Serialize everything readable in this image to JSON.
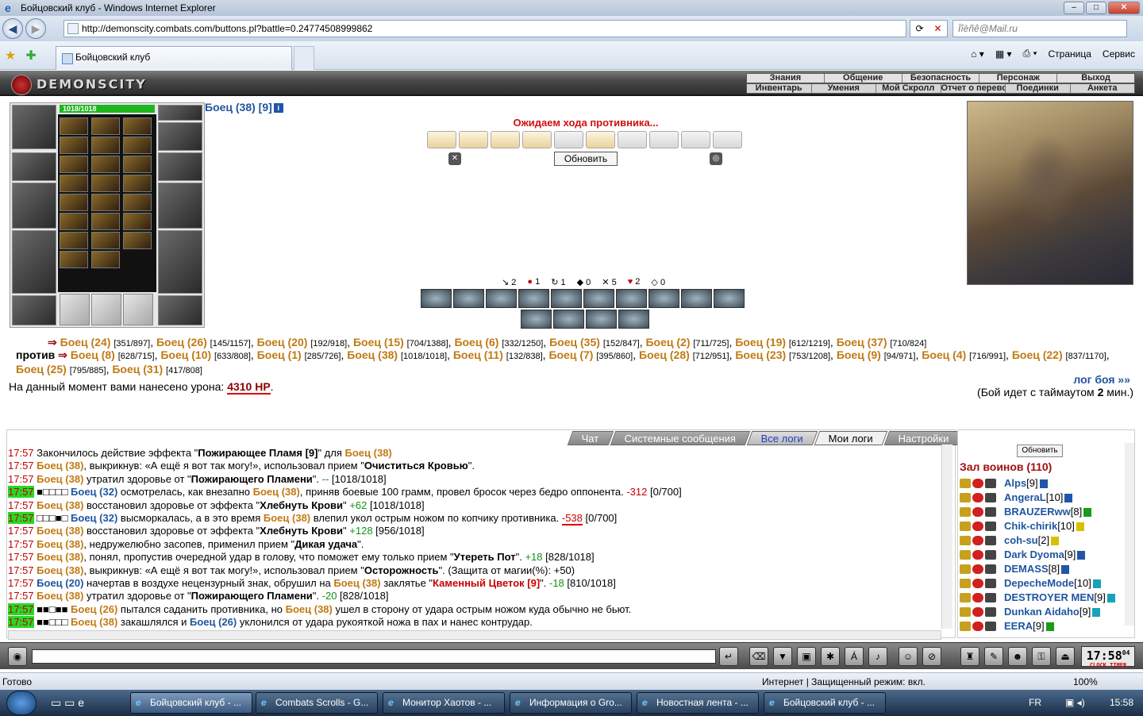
{
  "window": {
    "title": "Бойцовский клуб - Windows Internet Explorer"
  },
  "address": {
    "url": "http://demonscity.combats.com/buttons.pl?battle=0.24774508999862",
    "search_placeholder": "Ïîèñê@Mail.ru"
  },
  "tab": {
    "label": "Бойцовский клуб"
  },
  "toolbar": {
    "page": "Страница",
    "service": "Сервис"
  },
  "game": {
    "logo": "DEMONSCITY",
    "menu_top": [
      "Знания",
      "Общение",
      "Безопасность",
      "Персонаж",
      "Выход"
    ],
    "menu_bottom": [
      "Инвентарь",
      "Умения",
      "Мой Скролл",
      "Отчет о переводах",
      "Поединки",
      "Анкета"
    ],
    "hp": "1018/1018",
    "fighter_name": "Боец (38) [9]",
    "waiting": "Ожидаем хода противника...",
    "refresh_button": "Обновить",
    "stats": [
      "2",
      "1",
      "1",
      "0",
      "5",
      "2",
      "0"
    ],
    "team1": [
      {
        "name": "Боец (24)",
        "hp": "[351/897]"
      },
      {
        "name": "Боец (26)",
        "hp": "[145/1157]"
      },
      {
        "name": "Боец (20)",
        "hp": "[192/918]"
      },
      {
        "name": "Боец (15)",
        "hp": "[704/1388]"
      },
      {
        "name": "Боец (6)",
        "hp": "[332/1250]"
      },
      {
        "name": "Боец (35)",
        "hp": "[152/847]"
      },
      {
        "name": "Боец (2)",
        "hp": "[711/725]"
      },
      {
        "name": "Боец (19)",
        "hp": "[612/1219]"
      },
      {
        "name": "Боец (37)",
        "hp": "[710/824]"
      }
    ],
    "versus": "против",
    "team2": [
      {
        "name": "Боец (8)",
        "hp": "[628/715]"
      },
      {
        "name": "Боец (10)",
        "hp": "[633/808]"
      },
      {
        "name": "Боец (1)",
        "hp": "[285/726]"
      },
      {
        "name": "Боец (38)",
        "hp": "[1018/1018]"
      },
      {
        "name": "Боец (11)",
        "hp": "[132/838]"
      },
      {
        "name": "Боец (7)",
        "hp": "[395/860]"
      },
      {
        "name": "Боец (28)",
        "hp": "[712/951]"
      },
      {
        "name": "Боец (23)",
        "hp": "[753/1208]"
      },
      {
        "name": "Боец (9)",
        "hp": "[94/971]"
      },
      {
        "name": "Боец (4)",
        "hp": "[716/991]"
      },
      {
        "name": "Боец (22)",
        "hp": "[837/1170]"
      },
      {
        "name": "Боец (25)",
        "hp": "[795/885]"
      },
      {
        "name": "Боец (31)",
        "hp": "[417/808]"
      }
    ],
    "damage_text": "На данный момент вами нанесено урона:",
    "damage_value": "4310 HP",
    "log_link": "лог боя »»",
    "timeout_text": "(Бой идет с таймаутом",
    "timeout_value": "2",
    "timeout_suffix": "мин.)"
  },
  "log_tabs": [
    "Чат",
    "Системные сообщения",
    "Все логи",
    "Мои логи",
    "Настройки"
  ],
  "log_lines": [
    {
      "time": "17:57",
      "hl": false,
      "parts": [
        [
          "t",
          "Закончилось действие эффекта \""
        ],
        [
          "b",
          "Пожирающее Пламя [9]"
        ],
        [
          "t",
          "\" для "
        ],
        [
          "bc",
          "Боец (38)"
        ]
      ]
    },
    {
      "time": "17:57",
      "hl": false,
      "parts": [
        [
          "bc",
          "Боец (38)"
        ],
        [
          "t",
          ", выкрикнув: «А ещё я вот так могу!», использовал прием \""
        ],
        [
          "b",
          "Очиститься Кровью"
        ],
        [
          "t",
          "\"."
        ]
      ]
    },
    {
      "time": "17:57",
      "hl": false,
      "parts": [
        [
          "bc",
          "Боец (38)"
        ],
        [
          "t",
          " утратил здоровье от \""
        ],
        [
          "b",
          "Пожирающего Пламени"
        ],
        [
          "t",
          "\". "
        ],
        [
          "gr",
          "--"
        ],
        [
          "t",
          " [1018/1018]"
        ]
      ]
    },
    {
      "time": "17:57",
      "hl": true,
      "parts": [
        [
          "t",
          "■□□□□ "
        ],
        [
          "bl",
          "Боец (32)"
        ],
        [
          "t",
          " осмотрелась, как внезапно "
        ],
        [
          "bc",
          "Боец (38)"
        ],
        [
          "t",
          ", приняв боевые 100 грамм, провел бросок через бедро оппонента. "
        ],
        [
          "rd",
          "-312"
        ],
        [
          "t",
          " [0/700]"
        ]
      ]
    },
    {
      "time": "17:57",
      "hl": false,
      "parts": [
        [
          "bc",
          "Боец (38)"
        ],
        [
          "t",
          " восстановил здоровье от эффекта \""
        ],
        [
          "b",
          "Хлебнуть Крови"
        ],
        [
          "t",
          "\" "
        ],
        [
          "gr",
          "+62"
        ],
        [
          "t",
          " [1018/1018]"
        ]
      ]
    },
    {
      "time": "17:57",
      "hl": true,
      "parts": [
        [
          "t",
          "□□□■□ "
        ],
        [
          "bl",
          "Боец (32)"
        ],
        [
          "t",
          " высморкалась, а в это время "
        ],
        [
          "bc",
          "Боец (38)"
        ],
        [
          "t",
          " влепил укол острым ножом по копчику противника. "
        ],
        [
          "rdu",
          "-538"
        ],
        [
          "t",
          " [0/700]"
        ]
      ]
    },
    {
      "time": "17:57",
      "hl": false,
      "parts": [
        [
          "bc",
          "Боец (38)"
        ],
        [
          "t",
          " восстановил здоровье от эффекта \""
        ],
        [
          "b",
          "Хлебнуть Крови"
        ],
        [
          "t",
          "\" "
        ],
        [
          "gr",
          "+128"
        ],
        [
          "t",
          " [956/1018]"
        ]
      ]
    },
    {
      "time": "17:57",
      "hl": false,
      "parts": [
        [
          "bc",
          "Боец (38)"
        ],
        [
          "t",
          ", недружелюбно засопев, применил прием \""
        ],
        [
          "b",
          "Дикая удача"
        ],
        [
          "t",
          "\"."
        ]
      ]
    },
    {
      "time": "17:57",
      "hl": false,
      "parts": [
        [
          "bc",
          "Боец (38)"
        ],
        [
          "t",
          ", понял, пропустив очередной удар в голову, что поможет ему только прием \""
        ],
        [
          "b",
          "Утереть Пот"
        ],
        [
          "t",
          "\". "
        ],
        [
          "gr",
          "+18"
        ],
        [
          "t",
          " [828/1018]"
        ]
      ]
    },
    {
      "time": "17:57",
      "hl": false,
      "parts": [
        [
          "bc",
          "Боец (38)"
        ],
        [
          "t",
          ", выкрикнув: «А ещё я вот так могу!», использовал прием \""
        ],
        [
          "b",
          "Осторожность"
        ],
        [
          "t",
          "\". (Защита от магии(%): +50)"
        ]
      ]
    },
    {
      "time": "17:57",
      "hl": false,
      "parts": [
        [
          "bl",
          "Боец (20)"
        ],
        [
          "t",
          " начертав в воздухе нецензурный знак, обрушил на "
        ],
        [
          "bc",
          "Боец (38)"
        ],
        [
          "t",
          " заклятье \""
        ],
        [
          "rb",
          "Каменный Цветок [9]"
        ],
        [
          "t",
          "\". "
        ],
        [
          "gr",
          "-18"
        ],
        [
          "t",
          " [810/1018]"
        ]
      ]
    },
    {
      "time": "17:57",
      "hl": false,
      "parts": [
        [
          "bc",
          "Боец (38)"
        ],
        [
          "t",
          " утратил здоровье от \""
        ],
        [
          "b",
          "Пожирающего Пламени"
        ],
        [
          "t",
          "\". "
        ],
        [
          "gr",
          "-20"
        ],
        [
          "t",
          " [828/1018]"
        ]
      ]
    },
    {
      "time": "17:57",
      "hl": true,
      "parts": [
        [
          "t",
          "■■□■■ "
        ],
        [
          "bc",
          "Боец (26)"
        ],
        [
          "t",
          " пытался саданить противника, но "
        ],
        [
          "bc",
          "Боец (38)"
        ],
        [
          "t",
          " ушел в сторону от удара острым ножом куда обычно не бьют."
        ]
      ]
    },
    {
      "time": "17:57",
      "hl": true,
      "parts": [
        [
          "t",
          "■■□□□ "
        ],
        [
          "bc",
          "Боец (38)"
        ],
        [
          "t",
          " закашлялся и "
        ],
        [
          "bl",
          "Боец (26)"
        ],
        [
          "t",
          " уклонился от удара рукояткой ножа в пах и нанес контрудар."
        ]
      ]
    }
  ],
  "right_panel": {
    "refresh": "Обновить",
    "hall": "Зал воинов (110)",
    "users": [
      {
        "name": "Alps",
        "level": "[9]",
        "badge": "b"
      },
      {
        "name": "AngeraL",
        "level": "[10]",
        "badge": "b"
      },
      {
        "name": "BRAUZERww",
        "level": "[8]",
        "badge": "g"
      },
      {
        "name": "Chik-chirik",
        "level": "[10]",
        "badge": "y"
      },
      {
        "name": "coh-su",
        "level": "[2]",
        "badge": "y"
      },
      {
        "name": "Dark Dyoma",
        "level": "[9]",
        "badge": "b"
      },
      {
        "name": "DEMASS",
        "level": "[8]",
        "badge": "b"
      },
      {
        "name": "DepecheMode",
        "level": "[10]",
        "badge": "t"
      },
      {
        "name": "DESTROYER MEN",
        "level": "[9]",
        "badge": "t"
      },
      {
        "name": "Dunkan Aidaho",
        "level": "[9]",
        "badge": "t"
      },
      {
        "name": "EERA",
        "level": "[9]",
        "badge": "g"
      }
    ]
  },
  "clock": {
    "time": "17:58",
    "sec": "04",
    "label": "CLOCK TIMER"
  },
  "status": {
    "left": "Готово",
    "zone": "Интернет | Защищенный режим: вкл.",
    "zoom": "100%"
  },
  "taskbar": {
    "buttons": [
      "Бойцовский клуб - ...",
      "Combats Scrolls - G...",
      "Монитор Хаотов - ...",
      "Информация о Gro...",
      "Новостная лента - ...",
      "Бойцовский клуб - ..."
    ],
    "lang": "FR",
    "time": "15:58"
  }
}
